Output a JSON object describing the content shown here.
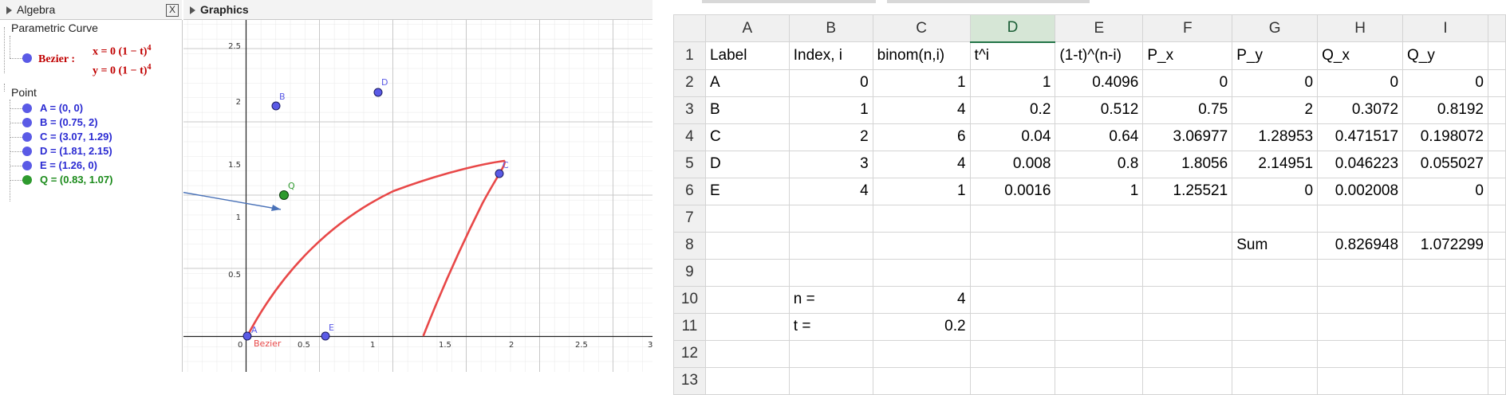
{
  "algebra": {
    "title": "Algebra",
    "close_glyph": "X",
    "categories": {
      "curve": "Parametric Curve",
      "point": "Point"
    },
    "bezier": {
      "name": "Bezier :",
      "eq_x": "x = 0  (1 − t)",
      "eq_y": "y = 0  (1 − t)",
      "exp": "4"
    },
    "points": [
      {
        "text": "A = (0, 0)"
      },
      {
        "text": "B = (0.75, 2)"
      },
      {
        "text": "C = (3.07, 1.29)"
      },
      {
        "text": "D = (1.81, 2.15)"
      },
      {
        "text": "E = (1.26, 0)"
      },
      {
        "text": "Q = (0.83, 1.07)"
      }
    ],
    "colors": {
      "point": "#5a5ae6",
      "point_text": "#2a2ad2",
      "q": "#1a8a1a",
      "curve": "#e84848",
      "eq": "#c00000"
    }
  },
  "graphics": {
    "title": "Graphics",
    "x_ticks": [
      "0",
      "0.5",
      "1",
      "1.5",
      "2",
      "2.5",
      "3"
    ],
    "y_ticks": [
      "0.5",
      "1",
      "1.5",
      "2",
      "2.5"
    ],
    "labels": {
      "A": "A",
      "B": "B",
      "C": "C",
      "D": "D",
      "E": "E",
      "Q": "Q",
      "curve": "Bezier"
    }
  },
  "spreadsheet": {
    "columns": [
      "A",
      "B",
      "C",
      "D",
      "E",
      "F",
      "G",
      "H",
      "I"
    ],
    "selected_column": "D",
    "rows": [
      {
        "n": "1",
        "cells": [
          "Label",
          "Index, i",
          "binom(n,i)",
          "t^i",
          "(1-t)^(n-i)",
          "P_x",
          "P_y",
          "Q_x",
          "Q_y"
        ]
      },
      {
        "n": "2",
        "cells": [
          "A",
          "0",
          "1",
          "1",
          "0.4096",
          "0",
          "0",
          "0",
          "0"
        ]
      },
      {
        "n": "3",
        "cells": [
          "B",
          "1",
          "4",
          "0.2",
          "0.512",
          "0.75",
          "2",
          "0.3072",
          "0.8192"
        ]
      },
      {
        "n": "4",
        "cells": [
          "C",
          "2",
          "6",
          "0.04",
          "0.64",
          "3.06977",
          "1.28953",
          "0.471517",
          "0.198072"
        ]
      },
      {
        "n": "5",
        "cells": [
          "D",
          "3",
          "4",
          "0.008",
          "0.8",
          "1.8056",
          "2.14951",
          "0.046223",
          "0.055027"
        ]
      },
      {
        "n": "6",
        "cells": [
          "E",
          "4",
          "1",
          "0.0016",
          "1",
          "1.25521",
          "0",
          "0.002008",
          "0"
        ]
      },
      {
        "n": "7",
        "cells": [
          "",
          "",
          "",
          "",
          "",
          "",
          "",
          "",
          ""
        ]
      },
      {
        "n": "8",
        "cells": [
          "",
          "",
          "",
          "",
          "",
          "",
          "Sum",
          "0.826948",
          "1.072299"
        ]
      },
      {
        "n": "9",
        "cells": [
          "",
          "",
          "",
          "",
          "",
          "",
          "",
          "",
          ""
        ]
      },
      {
        "n": "10",
        "cells": [
          "",
          "n =",
          "4",
          "",
          "",
          "",
          "",
          "",
          ""
        ]
      },
      {
        "n": "11",
        "cells": [
          "",
          "t =",
          "0.2",
          "",
          "",
          "",
          "",
          "",
          ""
        ]
      },
      {
        "n": "12",
        "cells": [
          "",
          "",
          "",
          "",
          "",
          "",
          "",
          "",
          ""
        ]
      },
      {
        "n": "13",
        "cells": [
          "",
          "",
          "",
          "",
          "",
          "",
          "",
          "",
          ""
        ]
      }
    ]
  }
}
